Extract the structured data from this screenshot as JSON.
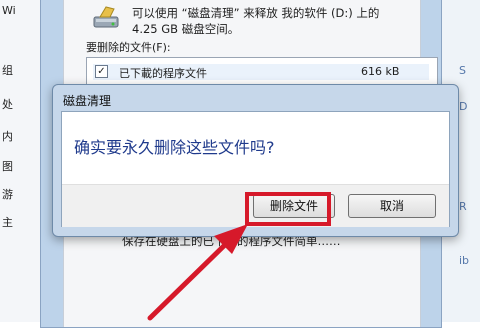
{
  "background_window": {
    "left_items": [
      "Wi",
      "组",
      "处",
      "内",
      "图",
      "游",
      "主"
    ],
    "right_items": [
      "S",
      "D",
      "R",
      "ib"
    ]
  },
  "cleanup_window": {
    "description_line1": "可以使用 “磁盘清理” 来释放 我的软件 (D:) 上的",
    "description_line2": "4.25 GB 磁盘空间。",
    "files_label": "要删除的文件(F):",
    "file_row": {
      "name": "已下載的程序文件",
      "size": "616 kB",
      "checked": true
    },
    "bottom_text": "保存在硬盘上的已下载的程序文件简单……"
  },
  "dialog": {
    "title": "磁盘清理",
    "message": "确实要永久删除这些文件吗?",
    "delete_button": "删除文件",
    "cancel_button": "取消"
  },
  "colors": {
    "highlight": "#d6192a",
    "arrow": "#d6192a",
    "message_text": "#1f3a8c"
  }
}
